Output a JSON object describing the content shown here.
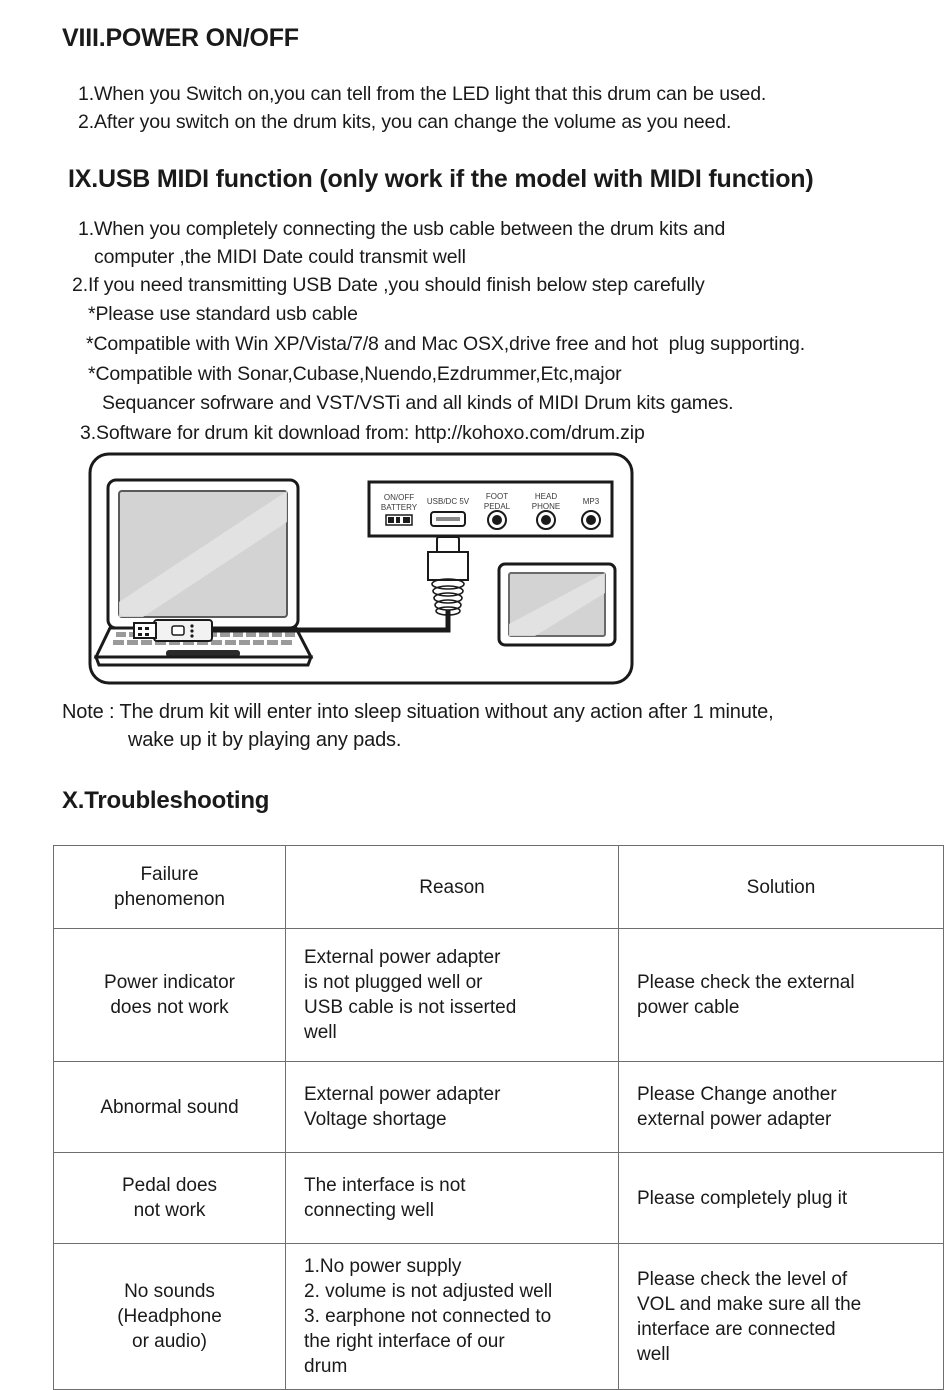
{
  "sections": {
    "power": {
      "heading": "VIII.POWER ON/OFF",
      "lines": [
        "1.When you Switch on,you can tell from the LED light that this drum can be used.",
        "2.After you switch on the drum kits, you can change the volume as you need."
      ]
    },
    "usb_midi": {
      "heading": "IX.USB MIDI function (only work if the model with MIDI function)",
      "item1_a": "1.When you completely connecting the usb cable between the drum kits and",
      "item1_b": "computer ,the MIDI Date could transmit well",
      "item2": "2.If you need transmitting USB Date ,you should finish below step carefully",
      "bullet1": "*Please use standard usb cable",
      "bullet2": "*Compatible with Win XP/Vista/7/8 and Mac OSX,drive free and hot  plug supporting.",
      "bullet3_a": "*Compatible with Sonar,Cubase,Nuendo,Ezdrummer,Etc,major",
      "bullet3_b": "Sequancer sofrware and VST/VSTi and all kinds of MIDI Drum kits games.",
      "item3": "3.Software for drum kit download from: http://kohoxo.com/drum.zip"
    },
    "note": {
      "line1": "Note : The drum kit will enter into sleep situation without any action after 1 minute,",
      "line2": "wake up it by playing any pads."
    },
    "troubleshooting": {
      "heading": "X.Troubleshooting"
    }
  },
  "illustration": {
    "panel_labels": {
      "power": "ON/OFF\nBATTERY",
      "usb": "USB/DC 5V",
      "foot_pedal": "FOOT\nPEDAL",
      "headphone": "HEAD\nPHONE",
      "mp3": "MP3"
    },
    "power_label_line1": "ON/OFF",
    "power_label_line2": "BATTERY",
    "usb_label": "USB/DC 5V",
    "pedal_label_line1": "FOOT",
    "pedal_label_line2": "PEDAL",
    "phone_label_line1": "HEAD",
    "phone_label_line2": "PHONE",
    "mp3_label": "MP3"
  },
  "table": {
    "headers": [
      "Failure\nphenomenon",
      "Reason",
      "Solution"
    ],
    "rows": [
      {
        "failure": "Power indicator\ndoes not work",
        "reason": "External power adapter\nis not plugged well or\nUSB cable is not isserted\nwell",
        "solution": "Please check the external\npower cable"
      },
      {
        "failure": "Abnormal sound",
        "reason": "External power adapter\nVoltage shortage",
        "solution": "Please Change another\nexternal power adapter"
      },
      {
        "failure": "Pedal does\nnot  work",
        "reason": "The  interface  is  not\nconnecting  well",
        "solution": "Please completely plug it"
      },
      {
        "failure": "No sounds\n(Headphone\nor audio)",
        "reason": "1.No power supply\n2. volume is not adjusted well\n3. earphone not connected to\nthe right interface of our\ndrum",
        "solution": "Please check the level of\nVOL and make sure all the\ninterface are connected\nwell"
      }
    ]
  },
  "colors": {
    "text": "#1a1a1a",
    "table_border": "#6e6e6e",
    "line_art": "#1a1a1a",
    "screen_fill": "#d3d3d3"
  }
}
